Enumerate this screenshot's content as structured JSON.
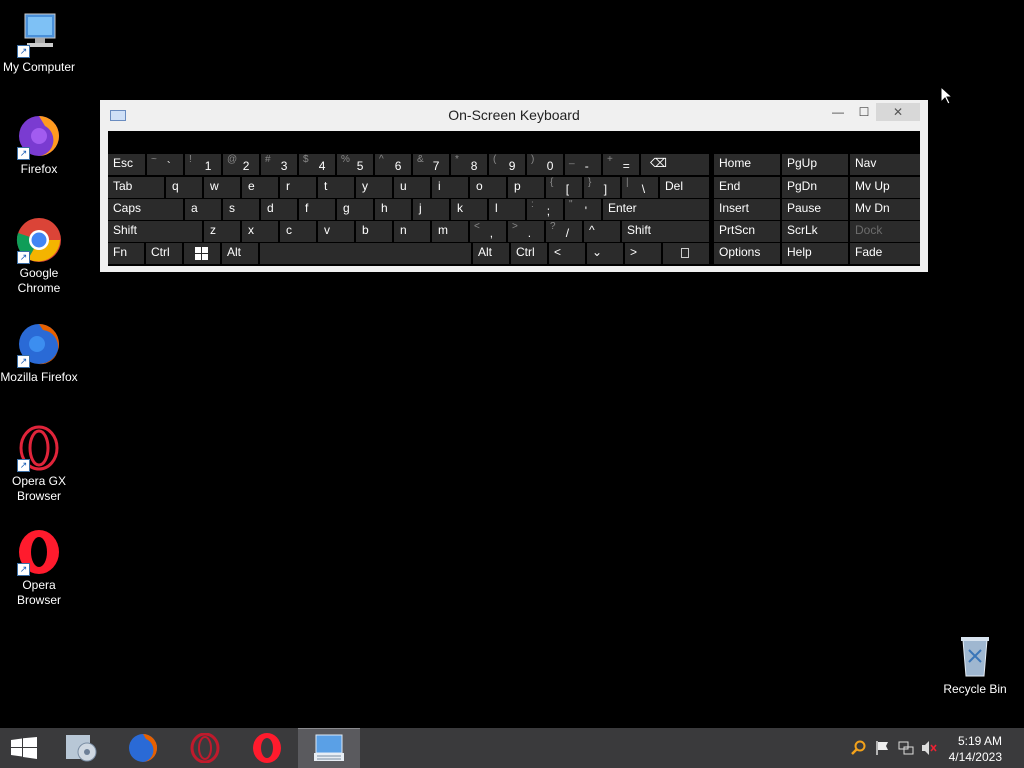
{
  "desktop": {
    "icons": [
      {
        "label": "My Computer"
      },
      {
        "label": "Firefox"
      },
      {
        "label": "Google Chrome"
      },
      {
        "label": "Mozilla Firefox"
      },
      {
        "label": "Opera GX Browser"
      },
      {
        "label": "Opera Browser"
      },
      {
        "label": "Recycle Bin"
      }
    ]
  },
  "osk": {
    "title": "On-Screen Keyboard",
    "window_buttons": {
      "minimize": "—",
      "maximize": "☐",
      "close": "✕"
    },
    "keys": {
      "esc": "Esc",
      "tab": "Tab",
      "caps": "Caps",
      "shift": "Shift",
      "fn": "Fn",
      "ctrl": "Ctrl",
      "alt": "Alt",
      "del": "Del",
      "enter": "Enter",
      "home": "Home",
      "pgup": "PgUp",
      "nav": "Nav",
      "end": "End",
      "pgdn": "PgDn",
      "mvup": "Mv Up",
      "insert": "Insert",
      "pause": "Pause",
      "mvdn": "Mv Dn",
      "prtscn": "PrtScn",
      "scrlk": "ScrLk",
      "dock": "Dock",
      "options": "Options",
      "help": "Help",
      "fade": "Fade",
      "left": "<",
      "down": "⌄",
      "right": ">",
      "up": "^",
      "backspace": "⌫"
    },
    "row1": [
      {
        "sub": "~",
        "main": "`"
      },
      {
        "sub": "!",
        "main": "1"
      },
      {
        "sub": "@",
        "main": "2"
      },
      {
        "sub": "#",
        "main": "3"
      },
      {
        "sub": "$",
        "main": "4"
      },
      {
        "sub": "%",
        "main": "5"
      },
      {
        "sub": "^",
        "main": "6"
      },
      {
        "sub": "&",
        "main": "7"
      },
      {
        "sub": "*",
        "main": "8"
      },
      {
        "sub": "(",
        "main": "9"
      },
      {
        "sub": ")",
        "main": "0"
      },
      {
        "sub": "_",
        "main": "-"
      },
      {
        "sub": "+",
        "main": "="
      }
    ],
    "row2": [
      "q",
      "w",
      "e",
      "r",
      "t",
      "y",
      "u",
      "i",
      "o",
      "p"
    ],
    "row2_extra": [
      {
        "sub": "{",
        "main": "["
      },
      {
        "sub": "}",
        "main": "]"
      },
      {
        "sub": "|",
        "main": "\\"
      }
    ],
    "row3": [
      "a",
      "s",
      "d",
      "f",
      "g",
      "h",
      "j",
      "k",
      "l"
    ],
    "row3_extra": [
      {
        "sub": ":",
        "main": ";"
      },
      {
        "sub": "\"",
        "main": "'"
      }
    ],
    "row4": [
      "z",
      "x",
      "c",
      "v",
      "b",
      "n",
      "m"
    ],
    "row4_extra": [
      {
        "sub": "<",
        "main": ","
      },
      {
        "sub": ">",
        "main": "."
      },
      {
        "sub": "?",
        "main": "/"
      }
    ]
  },
  "tray": {
    "time": "5:19 AM",
    "date": "4/14/2023"
  },
  "colors": {
    "key_bg": "#2b2b2b",
    "taskbar": "#3a3a3c",
    "desktop": "#000000"
  }
}
